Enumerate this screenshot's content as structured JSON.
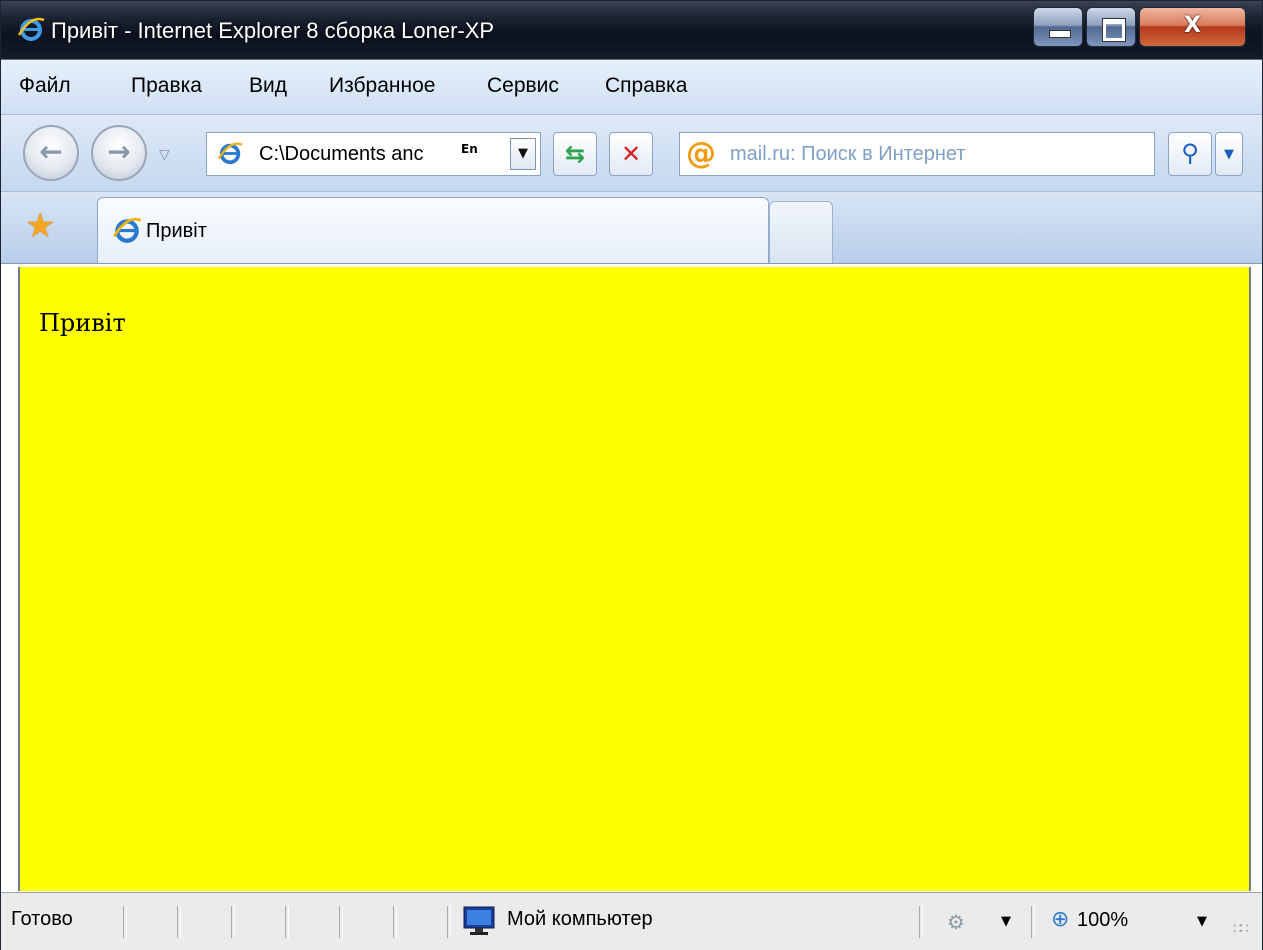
{
  "window": {
    "title": "Привіт - Internet Explorer 8 сборка Loner-XP",
    "controls": {
      "minimize": "",
      "maximize": "",
      "close": "X"
    }
  },
  "menu": {
    "items": [
      "Файл",
      "Правка",
      "Вид",
      "Избранное",
      "Сервис",
      "Справка"
    ]
  },
  "navigation": {
    "address": "C:\\Documents anc",
    "language_indicator": "En",
    "search_placeholder": "mail.ru: Поиск в Интернет"
  },
  "tabs": [
    {
      "label": "Привіт",
      "active": true
    }
  ],
  "page": {
    "body_text": "Привіт",
    "background": "#ffff00"
  },
  "status": {
    "text": "Готово",
    "zone": "Мой компьютер",
    "zoom": "100%"
  },
  "colors": {
    "titlebar": "#0c121e",
    "toolbar": "#cfdff3",
    "accent": "#2c6fd1",
    "close_button": "#b53a1d"
  },
  "icons": {
    "title": "ie-logo-icon",
    "back": "back-arrow-icon",
    "forward": "forward-arrow-icon",
    "refresh": "refresh-icon",
    "stop": "stop-icon",
    "search": "magnifier-icon",
    "favorites": "star-icon",
    "zone": "computer-icon",
    "zoom": "zoom-icon"
  }
}
